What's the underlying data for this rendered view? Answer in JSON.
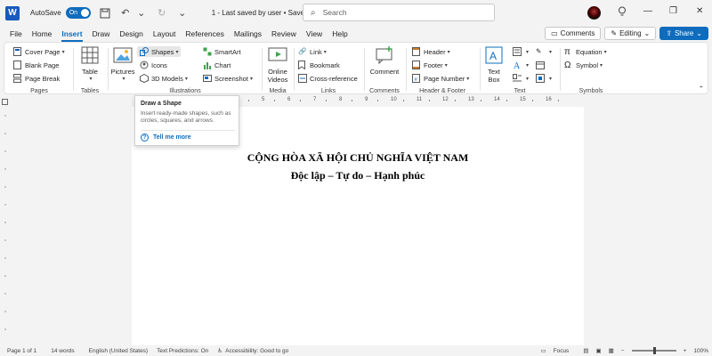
{
  "titlebar": {
    "logo_letter": "W",
    "autosave_label": "AutoSave",
    "autosave_state": "On",
    "doc_status": "1  -  Last saved by user • Saved",
    "search_placeholder": "Search"
  },
  "menu": {
    "tabs": [
      "File",
      "Home",
      "Insert",
      "Draw",
      "Design",
      "Layout",
      "References",
      "Mailings",
      "Review",
      "View",
      "Help"
    ],
    "active_tab": "Insert",
    "comments_label": "Comments",
    "editing_label": "Editing",
    "share_label": "Share"
  },
  "ribbon": {
    "pages": {
      "label": "Pages",
      "cover_page": "Cover Page",
      "blank_page": "Blank Page",
      "page_break": "Page Break"
    },
    "tables": {
      "label": "Tables",
      "table": "Table"
    },
    "illustrations": {
      "label": "Illustrations",
      "pictures": "Pictures",
      "shapes": "Shapes",
      "icons": "Icons",
      "models": "3D Models",
      "smartart": "SmartArt",
      "chart": "Chart",
      "screenshot": "Screenshot"
    },
    "media": {
      "label": "Media",
      "online_videos_1": "Online",
      "online_videos_2": "Videos"
    },
    "links": {
      "label": "Links",
      "link": "Link",
      "bookmark": "Bookmark",
      "cross_reference": "Cross-reference"
    },
    "comments": {
      "label": "Comments",
      "comment": "Comment"
    },
    "header_footer": {
      "label": "Header & Footer",
      "header": "Header",
      "footer": "Footer",
      "page_number": "Page Number"
    },
    "text": {
      "label": "Text",
      "text_box_1": "Text",
      "text_box_2": "Box"
    },
    "symbols": {
      "label": "Symbols",
      "equation": "Equation",
      "symbol": "Symbol"
    }
  },
  "tooltip": {
    "title": "Draw a Shape",
    "description": "Insert ready-made shapes, such as circles, squares, and arrows.",
    "link": "Tell me more"
  },
  "ruler": [
    "1",
    "2",
    "3",
    "4",
    "5",
    "6",
    "7",
    "8",
    "9",
    "10",
    "11",
    "12",
    "13",
    "14",
    "15",
    "16"
  ],
  "document": {
    "line1": "CỘNG HÒA XÃ HỘI CHỦ NGHĨA VIỆT NAM",
    "line2": "Độc lập – Tự do – Hạnh phúc"
  },
  "statusbar": {
    "page": "Page 1 of 1",
    "words": "14 words",
    "language": "English (United States)",
    "predictions": "Text Predictions: On",
    "accessibility": "Accessibility: Good to go",
    "focus": "Focus",
    "zoom": "100%"
  },
  "colors": {
    "accent": "#0f6cbd",
    "word_blue": "#185abd"
  }
}
